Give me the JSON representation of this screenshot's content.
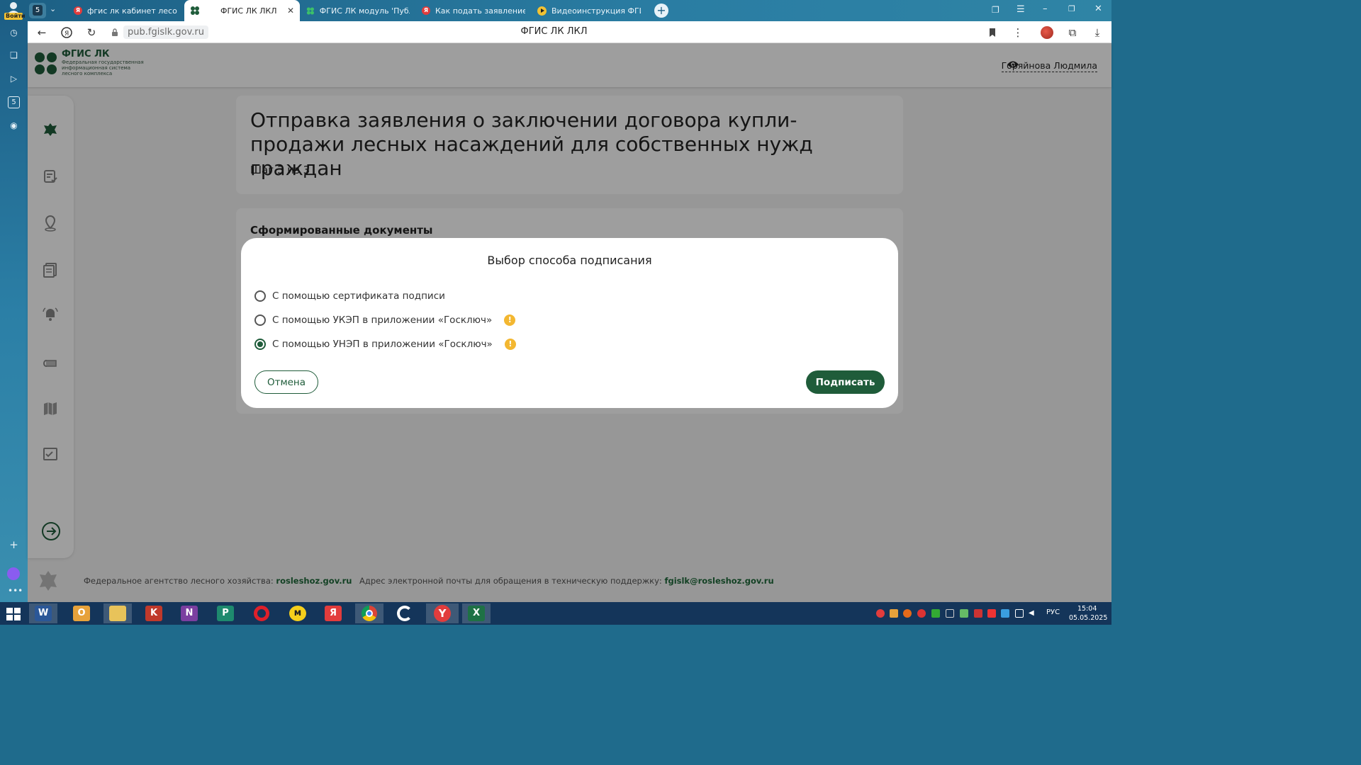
{
  "browser": {
    "tab_counter": "5",
    "login_label": "Войти",
    "tabs": [
      {
        "title": "фгис лк кабинет лесопол",
        "icon": "yandex-icon"
      },
      {
        "title": "ФГИС ЛК ЛКЛ",
        "icon": "fgis-icon"
      },
      {
        "title": "ФГИС ЛК модуль 'Публи",
        "icon": "fgis-icon"
      },
      {
        "title": "Как подать заявление на",
        "icon": "yandex-icon"
      },
      {
        "title": "Видеоинструкция ФГИС",
        "icon": "video-icon"
      }
    ],
    "url_host": "pub.fgislk.gov.ru",
    "page_title": "ФГИС ЛК ЛКЛ",
    "rail_counter": "5"
  },
  "site": {
    "logo_title": "ФГИС ЛК",
    "logo_sub": [
      "Федеральная государственная",
      "информационная система",
      "лесного комплекса"
    ],
    "user_name": "Горяйнова Людмила",
    "main_title": "Отправка заявления о заключении договора купли-продажи лесных насаждений для собственных нужд граждан",
    "step_label": "Шаг 3 из 3",
    "docs_title": "Сформированные документы",
    "footer": {
      "agency_label": "Федеральное агентство лесного хозяйства:",
      "agency_link": "rosleshoz.gov.ru",
      "support_label": "Адрес электронной почты для обращения в техническую поддержку:",
      "support_link": "fgislk@rosleshoz.gov.ru"
    }
  },
  "modal": {
    "title": "Выбор способа подписания",
    "options": [
      {
        "label": "С помощью сертификата подписи",
        "selected": false,
        "warning": false
      },
      {
        "label": "С помощью УКЭП в приложении «Госключ»",
        "selected": false,
        "warning": true
      },
      {
        "label": "С помощью УНЭП в приложении «Госключ»",
        "selected": true,
        "warning": true
      }
    ],
    "warning_glyph": "!",
    "cancel_label": "Отмена",
    "sign_label": "Подписать"
  },
  "taskbar": {
    "language": "РУС",
    "time": "15:04",
    "date": "05.05.2025"
  },
  "colors": {
    "brand_green": "#1f5c3a",
    "warning_yellow": "#f3b731"
  }
}
